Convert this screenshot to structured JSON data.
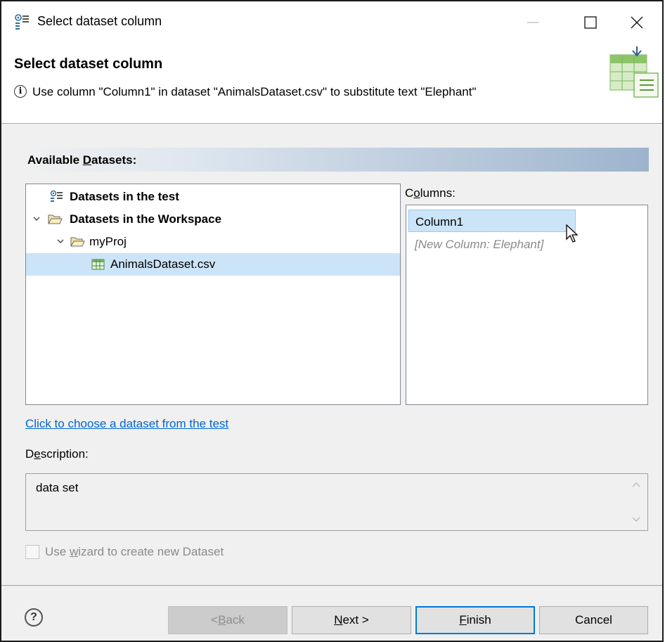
{
  "window": {
    "title": "Select dataset column"
  },
  "banner": {
    "title": "Select dataset column",
    "message": "Use column \"Column1\" in dataset \"AnimalsDataset.csv\" to substitute text \"Elephant\""
  },
  "section": {
    "label_pre": "Available ",
    "label_key": "D",
    "label_post": "atasets:"
  },
  "tree": {
    "items": [
      {
        "label": "Datasets in the test",
        "bold": true,
        "icon": "dataset-test-icon"
      },
      {
        "label": "Datasets in the Workspace",
        "bold": true,
        "icon": "folder-open-icon",
        "expanded": true
      },
      {
        "label": "myProj",
        "bold": false,
        "icon": "folder-open-icon",
        "expanded": true
      },
      {
        "label": "AnimalsDataset.csv",
        "bold": false,
        "icon": "table-icon",
        "selected": true
      }
    ]
  },
  "columns": {
    "label_pre": "C",
    "label_key": "o",
    "label_post": "lumns:",
    "items": [
      {
        "label": "Column1",
        "selected": true
      },
      {
        "label": "[New Column: Elephant]",
        "selected": false
      }
    ]
  },
  "link": {
    "text": "Click to choose a dataset from the test"
  },
  "description": {
    "label_pre": "D",
    "label_key": "e",
    "label_post": "scription:",
    "text": "data set"
  },
  "checkbox": {
    "label_pre": "Use ",
    "label_key": "w",
    "label_post": "izard to create new Dataset",
    "checked": false,
    "enabled": false
  },
  "buttons": {
    "back_pre": "< ",
    "back_key": "B",
    "back_post": "ack",
    "next_key": "N",
    "next_post": "ext >",
    "finish_key": "F",
    "finish_post": "inish",
    "cancel": "Cancel"
  },
  "colors": {
    "selection": "#cce4f7",
    "link": "#0066cc",
    "default_button_border": "#0078d7"
  }
}
